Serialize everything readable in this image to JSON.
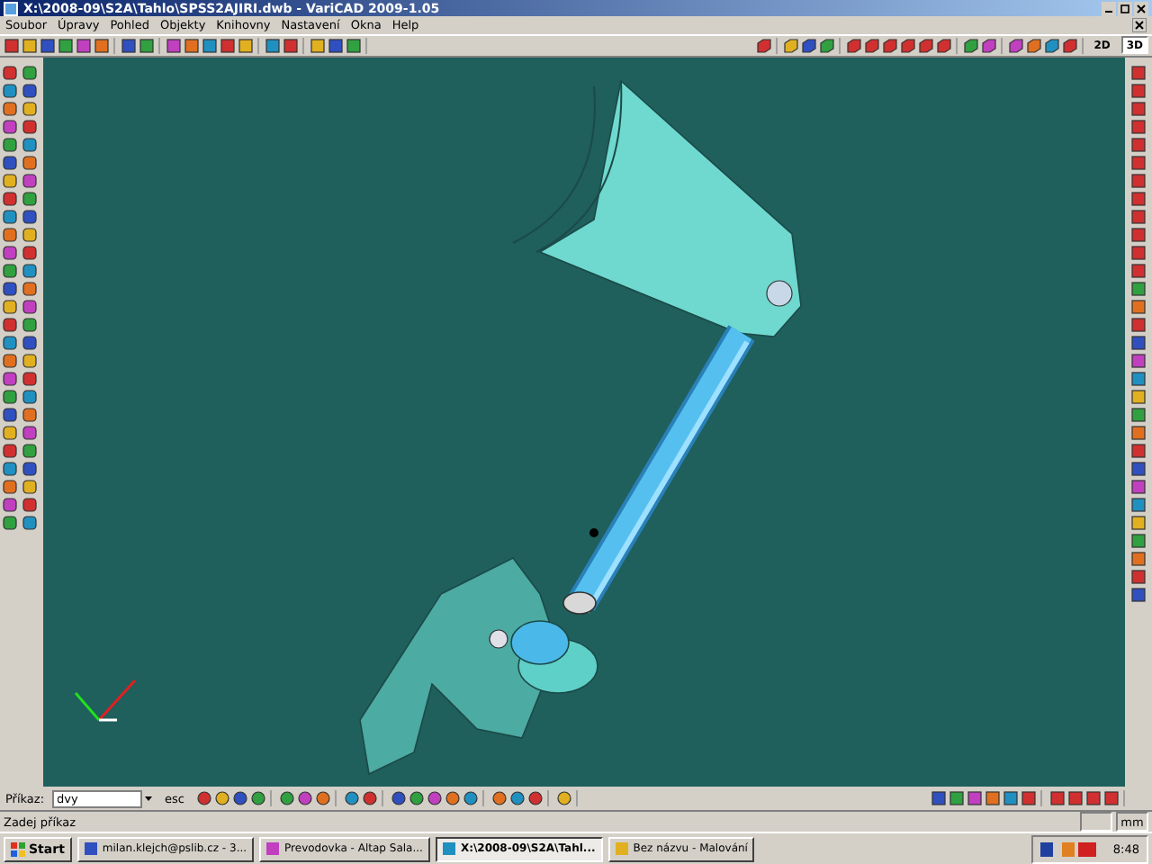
{
  "window": {
    "title": "X:\\2008-09\\S2A\\Tahlo\\SPSS2AJIRI.dwb - VariCAD 2009-1.05"
  },
  "menu": [
    "Soubor",
    "Úpravy",
    "Pohled",
    "Objekty",
    "Knihovny",
    "Nastavení",
    "Okna",
    "Help"
  ],
  "view_buttons": [
    {
      "label": "2D",
      "selected": false
    },
    {
      "label": "3D",
      "selected": true
    }
  ],
  "command": {
    "label": "Příkaz:",
    "value": "dvy",
    "escape": "esc"
  },
  "status_bar": {
    "prompt": "Zadej příkaz",
    "units": "mm"
  },
  "taskbar": {
    "start": "Start",
    "tasks": [
      {
        "label": "milan.klejch@pslib.cz - 3...",
        "selected": false
      },
      {
        "label": "Prevodovka - Altap Sala...",
        "selected": false
      },
      {
        "label": "X:\\2008-09\\S2A\\Tahl...",
        "selected": true
      },
      {
        "label": "Bez názvu - Malování",
        "selected": false
      }
    ],
    "clock": "8:48"
  }
}
